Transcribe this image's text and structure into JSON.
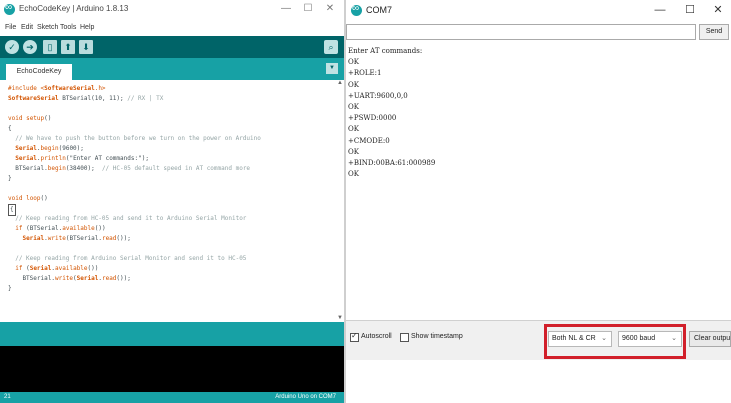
{
  "ide": {
    "title": "EchoCodeKey | Arduino 1.8.13",
    "window_controls": {
      "minimize": "—",
      "maximize": "☐",
      "close": "✕"
    },
    "menu": [
      "File",
      "Edit",
      "Sketch",
      "Tools",
      "Help"
    ],
    "toolbar": {
      "verify_icon": "✓",
      "upload_icon": "➔",
      "new_icon": "▯",
      "open_icon": "⬆",
      "save_icon": "⬇",
      "serial_monitor_icon": "⌕"
    },
    "tab_label": "EchoCodeKey",
    "tab_menu_icon": "▼",
    "status": {
      "line": "21",
      "board": "Arduino Uno on COM7"
    },
    "accent_color": "#17a1a5",
    "toolbar_color": "#006468"
  },
  "code": [
    [
      {
        "t": "#include <",
        "c": "kw"
      },
      {
        "t": "SoftwareSerial",
        "c": "cls"
      },
      {
        "t": ".h>",
        "c": "kw"
      }
    ],
    [
      {
        "t": "SoftwareSerial",
        "c": "cls"
      },
      {
        "t": " BTSerial(10, 11); ",
        "c": ""
      },
      {
        "t": "// RX | TX",
        "c": "cm"
      }
    ],
    [],
    [
      {
        "t": "void",
        "c": "kw"
      },
      {
        "t": " ",
        "c": ""
      },
      {
        "t": "setup",
        "c": "kw"
      },
      {
        "t": "()",
        "c": ""
      }
    ],
    [
      {
        "t": "{",
        "c": ""
      }
    ],
    [
      {
        "t": "  // We have to push the button before we turn on the power on Arduino",
        "c": "cm"
      }
    ],
    [
      {
        "t": "  ",
        "c": ""
      },
      {
        "t": "Serial",
        "c": "cls"
      },
      {
        "t": ".",
        "c": ""
      },
      {
        "t": "begin",
        "c": "fn"
      },
      {
        "t": "(9600);",
        "c": ""
      }
    ],
    [
      {
        "t": "  ",
        "c": ""
      },
      {
        "t": "Serial",
        "c": "cls"
      },
      {
        "t": ".",
        "c": ""
      },
      {
        "t": "println",
        "c": "fn"
      },
      {
        "t": "(\"Enter AT commands:\");",
        "c": ""
      }
    ],
    [
      {
        "t": "  BTSerial.",
        "c": ""
      },
      {
        "t": "begin",
        "c": "fn"
      },
      {
        "t": "(38400);  ",
        "c": ""
      },
      {
        "t": "// HC-05 default speed in AT command more",
        "c": "cm"
      }
    ],
    [
      {
        "t": "}",
        "c": ""
      }
    ],
    [],
    [
      {
        "t": "void",
        "c": "kw"
      },
      {
        "t": " ",
        "c": ""
      },
      {
        "t": "loop",
        "c": "kw"
      },
      {
        "t": "()",
        "c": ""
      }
    ],
    [
      {
        "t": "{",
        "c": "box"
      }
    ],
    [
      {
        "t": "  // Keep reading from HC-05 and send it to Arduino Serial Monitor",
        "c": "cm"
      }
    ],
    [
      {
        "t": "  ",
        "c": ""
      },
      {
        "t": "if",
        "c": "kw"
      },
      {
        "t": " (BTSerial.",
        "c": ""
      },
      {
        "t": "available",
        "c": "fn"
      },
      {
        "t": "())",
        "c": ""
      }
    ],
    [
      {
        "t": "    ",
        "c": ""
      },
      {
        "t": "Serial",
        "c": "cls"
      },
      {
        "t": ".",
        "c": ""
      },
      {
        "t": "write",
        "c": "fn"
      },
      {
        "t": "(BTSerial.",
        "c": ""
      },
      {
        "t": "read",
        "c": "fn"
      },
      {
        "t": "());",
        "c": ""
      }
    ],
    [],
    [
      {
        "t": "  // Keep reading from Arduino Serial Monitor and send it to HC-05",
        "c": "cm"
      }
    ],
    [
      {
        "t": "  ",
        "c": ""
      },
      {
        "t": "if",
        "c": "kw"
      },
      {
        "t": " (",
        "c": ""
      },
      {
        "t": "Serial",
        "c": "cls"
      },
      {
        "t": ".",
        "c": ""
      },
      {
        "t": "available",
        "c": "fn"
      },
      {
        "t": "())",
        "c": ""
      }
    ],
    [
      {
        "t": "    BTSerial.",
        "c": ""
      },
      {
        "t": "write",
        "c": "fn"
      },
      {
        "t": "(",
        "c": ""
      },
      {
        "t": "Serial",
        "c": "cls"
      },
      {
        "t": ".",
        "c": ""
      },
      {
        "t": "read",
        "c": "fn"
      },
      {
        "t": "());",
        "c": ""
      }
    ],
    [
      {
        "t": "}",
        "c": ""
      }
    ]
  ],
  "serial": {
    "title": "COM7",
    "window_controls": {
      "minimize": "—",
      "maximize": "☐",
      "close": "✕"
    },
    "send_label": "Send",
    "input_value": "",
    "output": [
      "Enter AT commands:",
      "OK",
      "+ROLE:1",
      "OK",
      "+UART:9600,0,0",
      "OK",
      "+PSWD:0000",
      "OK",
      "+CMODE:0",
      "OK",
      "+BIND:00BA:61:000989",
      "OK"
    ],
    "autoscroll_label": "Autoscroll",
    "autoscroll_checked": true,
    "timestamp_label": "Show timestamp",
    "timestamp_checked": false,
    "line_ending": "Both NL & CR",
    "baud": "9600 baud",
    "clear_label": "Clear output",
    "highlight_color": "#d11f2a"
  }
}
